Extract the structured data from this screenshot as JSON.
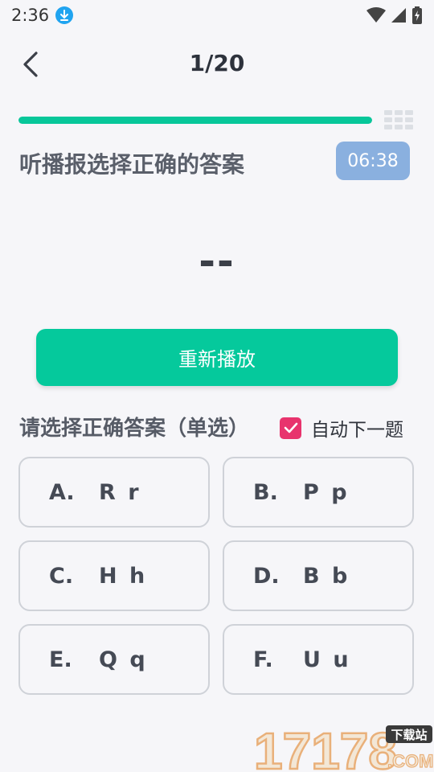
{
  "status_bar": {
    "time": "2:36"
  },
  "header": {
    "progress_text": "1/20"
  },
  "progress": {
    "current": 1,
    "total": 20,
    "fraction": 0.05
  },
  "question": {
    "title": "听播报选择正确的答案",
    "timer": "06:38",
    "answer_placeholder": "--"
  },
  "replay_button": {
    "label": "重新播放"
  },
  "selection": {
    "label": "请选择正确答案（单选）",
    "auto_next_label": "自动下一题",
    "auto_next_checked": true
  },
  "options": [
    {
      "key": "A.",
      "value": "R r"
    },
    {
      "key": "B.",
      "value": "P p"
    },
    {
      "key": "C.",
      "value": "H h"
    },
    {
      "key": "D.",
      "value": "B b"
    },
    {
      "key": "E.",
      "value": "Q q"
    },
    {
      "key": "F.",
      "value": "U u"
    }
  ],
  "watermark": {
    "number": "17178",
    "badge": "下载站",
    "suffix": ".COM"
  },
  "colors": {
    "accent": "#05c99c",
    "progress_fill": "#07c79a",
    "timer_bg": "#8ab0df",
    "checkbox": "#e8336d",
    "background": "#f6f6f9"
  },
  "icons": {
    "back": "chevron-left-icon",
    "grid": "grid-icon",
    "download": "download-icon",
    "wifi": "wifi-icon",
    "signal": "signal-icon",
    "battery": "battery-charging-icon",
    "check": "check-icon"
  }
}
